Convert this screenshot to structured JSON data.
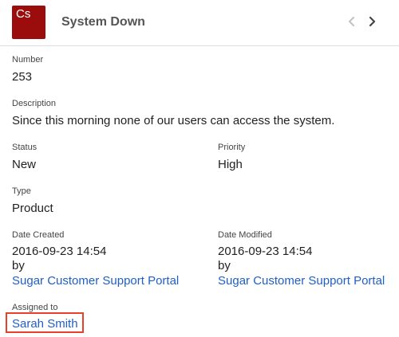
{
  "header": {
    "avatar_text": "Cs",
    "title": "System Down",
    "prev_icon": "chevron-left-icon",
    "next_icon": "chevron-right-icon"
  },
  "fields": {
    "number": {
      "label": "Number",
      "value": "253"
    },
    "description": {
      "label": "Description",
      "value": "Since this morning none of our users can access the system."
    },
    "status": {
      "label": "Status",
      "value": "New"
    },
    "priority": {
      "label": "Priority",
      "value": "High"
    },
    "type": {
      "label": "Type",
      "value": "Product"
    },
    "date_created": {
      "label": "Date Created",
      "value": "2016-09-23 14:54",
      "by": "by",
      "user": "Sugar Customer Support Portal"
    },
    "date_modified": {
      "label": "Date Modified",
      "value": "2016-09-23 14:54",
      "by": "by",
      "user": "Sugar Customer Support Portal"
    },
    "assigned_to": {
      "label": "Assigned to",
      "value": "Sarah Smith"
    }
  },
  "colors": {
    "avatar": "#9b0d0d",
    "link": "#1f5fc6",
    "highlight": "#e8402a"
  }
}
